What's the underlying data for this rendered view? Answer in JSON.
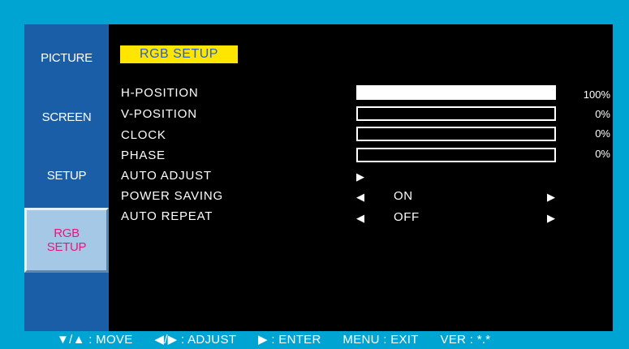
{
  "sidebar": {
    "tabs": [
      {
        "label": "PICTURE"
      },
      {
        "label": "SCREEN"
      },
      {
        "label": "SETUP"
      },
      {
        "label_line1": "RGB",
        "label_line2": "SETUP",
        "active": true
      }
    ]
  },
  "main": {
    "title": "RGB SETUP",
    "rows": [
      {
        "label": "H-POSITION",
        "level": 100,
        "percent": "100%"
      },
      {
        "label": "V-POSITION",
        "level": 0,
        "percent": "0%"
      },
      {
        "label": "CLOCK",
        "level": 0,
        "percent": "0%"
      },
      {
        "label": "PHASE",
        "level": 0,
        "percent": "0%"
      },
      {
        "label": "AUTO ADJUST",
        "enter_icon": "play-icon"
      },
      {
        "label": "POWER SAVING",
        "value": "ON",
        "left_icon": "left-triangle-icon",
        "right_icon": "right-triangle-icon"
      },
      {
        "label": "AUTO REPEAT",
        "value": "OFF",
        "left_icon": "left-triangle-icon",
        "right_icon": "right-triangle-icon"
      }
    ]
  },
  "footer": {
    "move": "▼/▲ : MOVE",
    "adjust": "◀/▶ : ADJUST",
    "enter": "▶ : ENTER",
    "exit": "MENU : EXIT",
    "ver": "VER : *.*"
  },
  "colors": {
    "frame": "#00a4d3",
    "sidebar": "#1b5ea8",
    "active_tab": "#a5c8e6",
    "active_text": "#e8167f",
    "title_bg": "#ffe600",
    "title_text": "#2a61c9"
  }
}
